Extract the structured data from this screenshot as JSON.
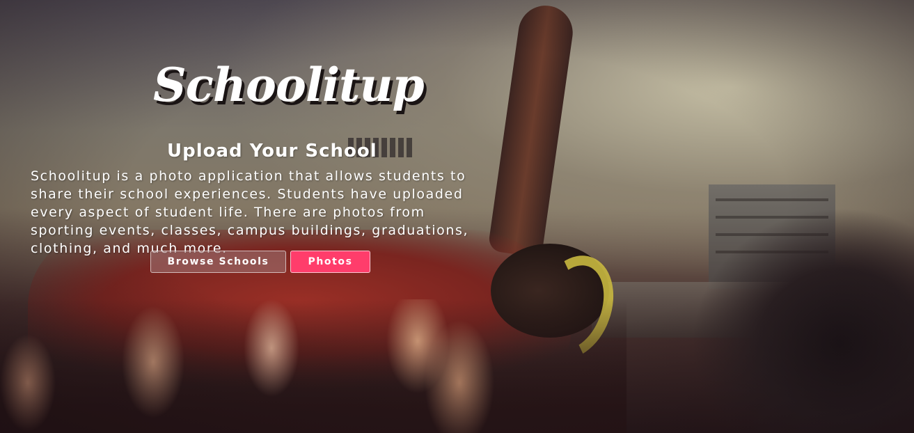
{
  "hero": {
    "logo_text": "Schoolitup",
    "headline": "Upload Your School",
    "description": "Schoolitup is a photo application that allows students to share their school experiences. Students have uploaded every aspect of student life. There are photos from sporting events, classes, campus buildings, graduations, clothing, and much more.",
    "buttons": {
      "browse_label": "Browse Schools",
      "photos_label": "Photos"
    }
  },
  "colors": {
    "photos_button": "#ff3d6b",
    "text": "#ffffff"
  }
}
